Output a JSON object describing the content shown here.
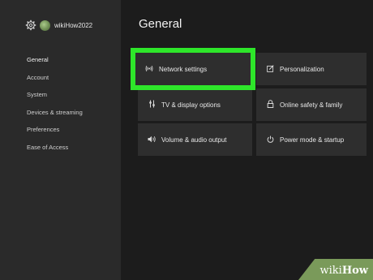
{
  "profile": {
    "gamertag": "wikiHow2022",
    "settings_icon": "gear-icon"
  },
  "nav": [
    {
      "label": "General",
      "active": true
    },
    {
      "label": "Account"
    },
    {
      "label": "System"
    },
    {
      "label": "Devices & streaming"
    },
    {
      "label": "Preferences"
    },
    {
      "label": "Ease of Access"
    }
  ],
  "page_title": "General",
  "tiles": {
    "network": {
      "label": "Network settings",
      "icon": "wireless-signal-icon"
    },
    "personalization": {
      "label": "Personalization",
      "icon": "edit-icon"
    },
    "tv_display": {
      "label": "TV & display options",
      "icon": "tv-display-icon"
    },
    "online_safety": {
      "label": "Online safety & family",
      "icon": "lock-icon"
    },
    "volume_audio": {
      "label": "Volume & audio output",
      "icon": "speaker-icon"
    },
    "power_mode": {
      "label": "Power mode & startup",
      "icon": "power-icon"
    }
  },
  "highlight_color": "#2ee62a",
  "watermark": {
    "prefix": "wiki",
    "suffix": "How"
  }
}
